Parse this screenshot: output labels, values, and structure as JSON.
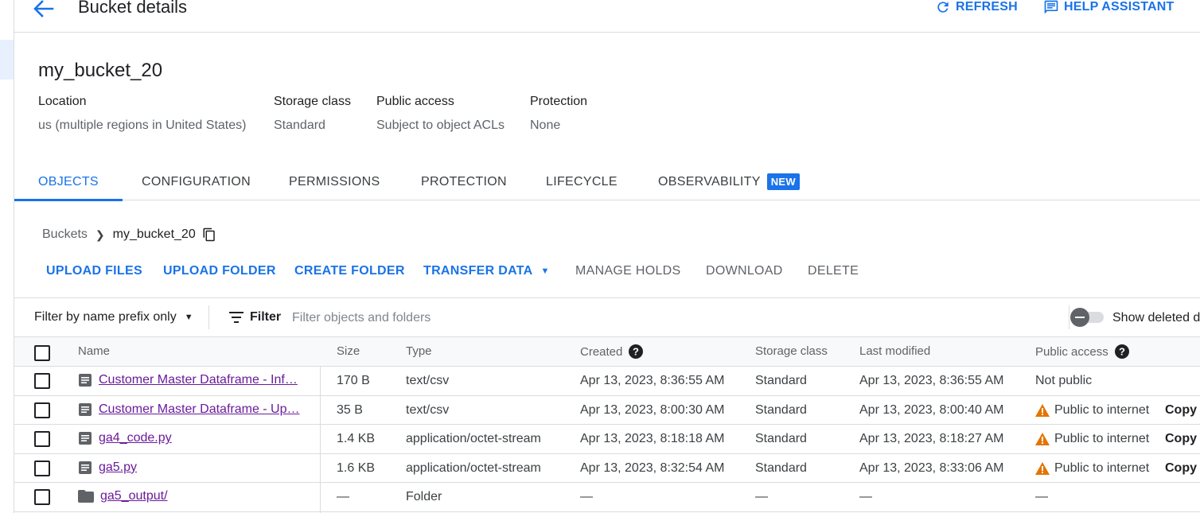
{
  "header": {
    "title": "Bucket details",
    "refresh_label": "REFRESH",
    "help_label": "HELP ASSISTANT"
  },
  "bucket": {
    "name": "my_bucket_20",
    "meta": [
      {
        "label": "Location",
        "value": "us (multiple regions in United States)"
      },
      {
        "label": "Storage class",
        "value": "Standard"
      },
      {
        "label": "Public access",
        "value": "Subject to object ACLs"
      },
      {
        "label": "Protection",
        "value": "None"
      }
    ]
  },
  "tabs": [
    {
      "label": "OBJECTS",
      "active": true
    },
    {
      "label": "CONFIGURATION"
    },
    {
      "label": "PERMISSIONS"
    },
    {
      "label": "PROTECTION"
    },
    {
      "label": "LIFECYCLE"
    },
    {
      "label": "OBSERVABILITY",
      "badge": "NEW"
    }
  ],
  "breadcrumb": {
    "root": "Buckets",
    "current": "my_bucket_20"
  },
  "actions": [
    {
      "label": "UPLOAD FILES",
      "enabled": true
    },
    {
      "label": "UPLOAD FOLDER",
      "enabled": true
    },
    {
      "label": "CREATE FOLDER",
      "enabled": true
    },
    {
      "label": "TRANSFER DATA",
      "enabled": true,
      "dropdown": true
    },
    {
      "label": "MANAGE HOLDS",
      "enabled": false
    },
    {
      "label": "DOWNLOAD",
      "enabled": false
    },
    {
      "label": "DELETE",
      "enabled": false
    }
  ],
  "filter": {
    "mode": "Filter by name prefix only",
    "button": "Filter",
    "placeholder": "Filter objects and folders",
    "show_deleted": "Show deleted d"
  },
  "table": {
    "columns": [
      "Name",
      "Size",
      "Type",
      "Created",
      "Storage class",
      "Last modified",
      "Public access"
    ],
    "rows": [
      {
        "kind": "file",
        "name": "Customer Master Dataframe - Inf…",
        "size": "170 B",
        "type": "text/csv",
        "created": "Apr 13, 2023, 8:36:55 AM",
        "storage": "Standard",
        "modified": "Apr 13, 2023, 8:36:55 AM",
        "access": "Not public",
        "warn": false,
        "copy": ""
      },
      {
        "kind": "file",
        "name": "Customer Master Dataframe - Up…",
        "size": "35 B",
        "type": "text/csv",
        "created": "Apr 13, 2023, 8:00:30 AM",
        "storage": "Standard",
        "modified": "Apr 13, 2023, 8:00:40 AM",
        "access": "Public to internet",
        "warn": true,
        "copy": "Copy U"
      },
      {
        "kind": "file",
        "name": "ga4_code.py",
        "size": "1.4 KB",
        "type": "application/octet-stream",
        "created": "Apr 13, 2023, 8:18:18 AM",
        "storage": "Standard",
        "modified": "Apr 13, 2023, 8:18:27 AM",
        "access": "Public to internet",
        "warn": true,
        "copy": "Copy U"
      },
      {
        "kind": "file",
        "name": "ga5.py",
        "size": "1.6 KB",
        "type": "application/octet-stream",
        "created": "Apr 13, 2023, 8:32:54 AM",
        "storage": "Standard",
        "modified": "Apr 13, 2023, 8:33:06 AM",
        "access": "Public to internet",
        "warn": true,
        "copy": "Copy U"
      },
      {
        "kind": "folder",
        "name": "ga5_output/",
        "size": "—",
        "type": "Folder",
        "created": "—",
        "storage": "—",
        "modified": "—",
        "access": "—",
        "warn": false,
        "copy": ""
      }
    ]
  },
  "colors": {
    "accent": "#1a73e8",
    "link_visited": "#6a1b9a",
    "warning": "#e37400"
  }
}
